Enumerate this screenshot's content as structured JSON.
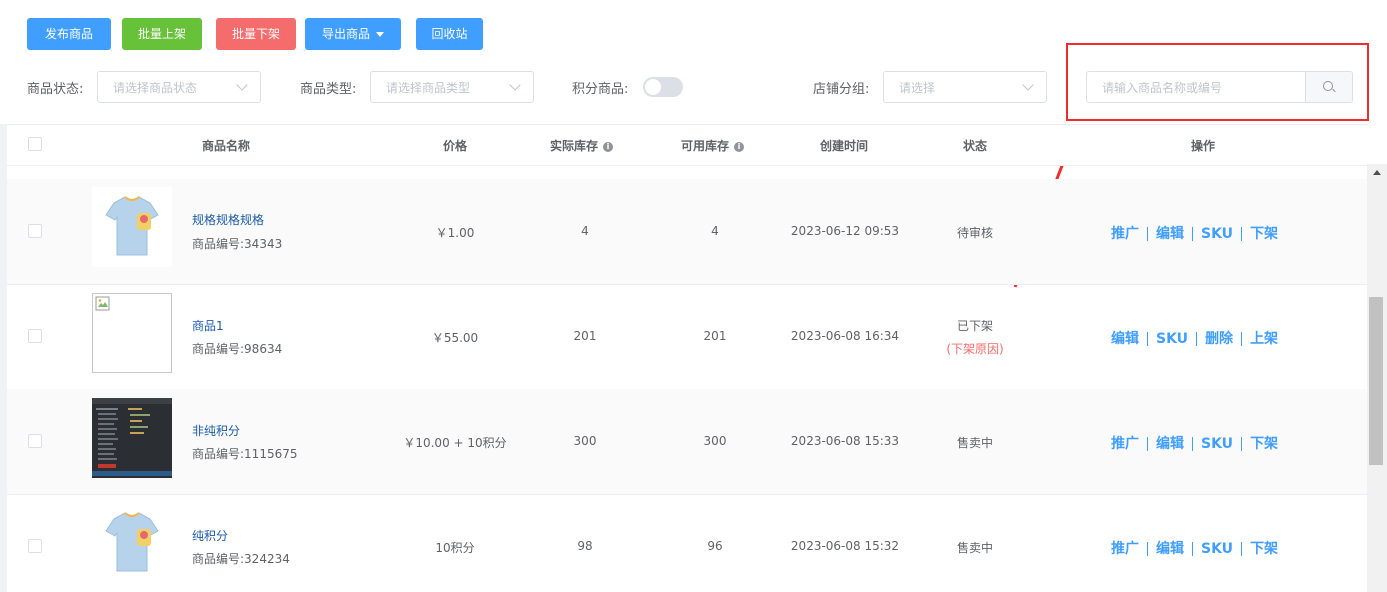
{
  "toolbar": {
    "publish": "发布商品",
    "batch_on": "批量上架",
    "batch_off": "批量下架",
    "export": "导出商品",
    "recycle": "回收站"
  },
  "filters": {
    "status_label": "商品状态:",
    "status_placeholder": "请选择商品状态",
    "type_label": "商品类型:",
    "type_placeholder": "请选择商品类型",
    "points_label": "积分商品:",
    "points_switch_on": false,
    "group_label": "店铺分组:",
    "group_placeholder": "请选择",
    "search_placeholder": "请输入商品名称或编号"
  },
  "table": {
    "headers": {
      "name": "商品名称",
      "price": "价格",
      "actual_stock": "实际库存",
      "available_stock": "可用库存",
      "created": "创建时间",
      "status": "状态",
      "ops": "操作"
    },
    "rows": [
      {
        "name": "规格规格规格",
        "code": "商品编号:34343",
        "price": "￥1.00",
        "actual": "4",
        "available": "4",
        "created": "2023-06-12 09:53",
        "status": "待审核",
        "reason": "",
        "thumb": "tshirt",
        "ops": [
          "推广",
          "编辑",
          "SKU",
          "下架"
        ]
      },
      {
        "name": "商品1",
        "code": "商品编号:98634",
        "price": "￥55.00",
        "actual": "201",
        "available": "201",
        "created": "2023-06-08 16:34",
        "status": "已下架",
        "reason": "(下架原因)",
        "thumb": "broken",
        "ops": [
          "编辑",
          "SKU",
          "删除",
          "上架"
        ]
      },
      {
        "name": "非纯积分",
        "code": "商品编号:1115675",
        "price": "￥10.00 + 10积分",
        "actual": "300",
        "available": "300",
        "created": "2023-06-08 15:33",
        "status": "售卖中",
        "reason": "",
        "thumb": "screenshot",
        "ops": [
          "推广",
          "编辑",
          "SKU",
          "下架"
        ]
      },
      {
        "name": "纯积分",
        "code": "商品编号:324234",
        "price": "10积分",
        "actual": "98",
        "available": "96",
        "created": "2023-06-08 15:32",
        "status": "售卖中",
        "reason": "",
        "thumb": "tshirt",
        "ops": [
          "推广",
          "编辑",
          "SKU",
          "下架"
        ]
      }
    ]
  },
  "colors": {
    "primary": "#409eff",
    "success": "#67c23a",
    "danger": "#f56c6c",
    "highlight": "#f02d2d"
  }
}
